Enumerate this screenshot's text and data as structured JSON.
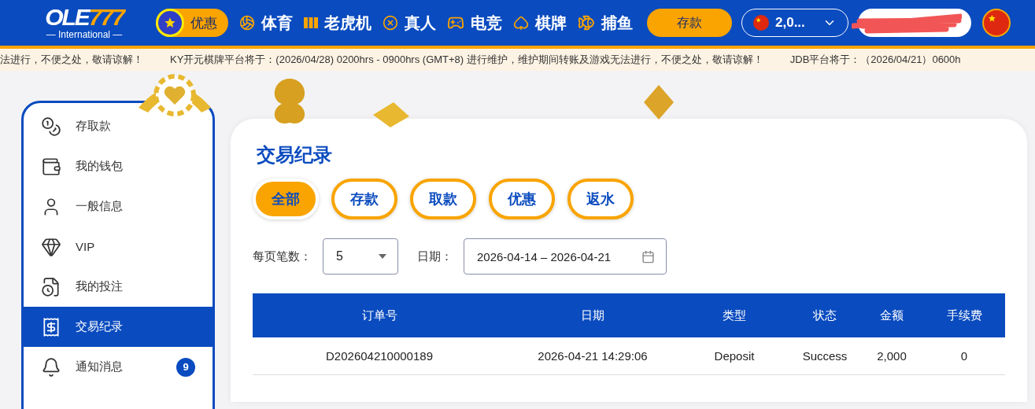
{
  "header": {
    "logo": {
      "main": "OLE",
      "accent": "777",
      "sub": "— International —"
    },
    "promo_button": "优惠",
    "nav": [
      {
        "label": "体育",
        "kind": "ball"
      },
      {
        "label": "老虎机",
        "kind": "slots"
      },
      {
        "label": "真人",
        "kind": "chip"
      },
      {
        "label": "电竞",
        "kind": "gamepad"
      },
      {
        "label": "棋牌",
        "kind": "cards"
      },
      {
        "label": "捕鱼",
        "kind": "fish"
      }
    ],
    "deposit_button": "存款",
    "balance": "2,0..."
  },
  "ticker": [
    "法进行，不便之处，敬请谅解！",
    "KY开元棋牌平台将于：(2026/04/28) 0200hrs - 0900hrs (GMT+8) 进行维护，维护期间转账及游戏无法进行，不便之处，敬请谅解！",
    "JDB平台将于：（2026/04/21）0600h"
  ],
  "sidebar": {
    "items": [
      {
        "label": "存取款",
        "kind": "coins",
        "selected": false
      },
      {
        "label": "我的钱包",
        "kind": "wallet",
        "selected": false
      },
      {
        "label": "一般信息",
        "kind": "user",
        "selected": false
      },
      {
        "label": "VIP",
        "kind": "gem",
        "selected": false
      },
      {
        "label": "我的投注",
        "kind": "bets",
        "selected": false
      },
      {
        "label": "交易纪录",
        "kind": "receipt",
        "selected": true
      },
      {
        "label": "通知消息",
        "kind": "bell",
        "selected": false,
        "badge": "9"
      }
    ]
  },
  "content": {
    "title": "交易纪录",
    "tabs": [
      {
        "label": "全部",
        "selected": true
      },
      {
        "label": "存款",
        "selected": false
      },
      {
        "label": "取款",
        "selected": false
      },
      {
        "label": "优惠",
        "selected": false
      },
      {
        "label": "返水",
        "selected": false
      }
    ],
    "page_size": {
      "label": "每页笔数：",
      "value": "5"
    },
    "date": {
      "label": "日期：",
      "value": "2026-04-14 – 2026-04-21"
    },
    "table": {
      "columns": [
        "订单号",
        "日期",
        "类型",
        "状态",
        "金额",
        "手续费"
      ],
      "rows": [
        [
          "D202604210000189",
          "2026-04-21 14:29:06",
          "Deposit",
          "Success",
          "2,000",
          "0"
        ]
      ]
    }
  }
}
